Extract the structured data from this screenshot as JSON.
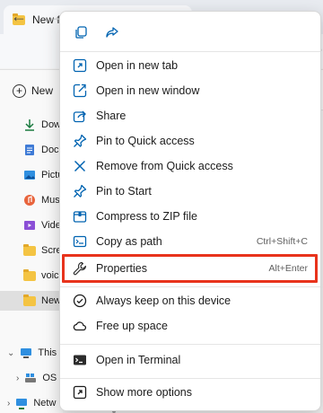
{
  "window": {
    "tab_title": "New fo",
    "address_hint": "p"
  },
  "command_bar": {
    "new_label": "New"
  },
  "sidebar": {
    "items": [
      {
        "label": "Down",
        "icon": "download-icon"
      },
      {
        "label": "Docu",
        "icon": "document-icon"
      },
      {
        "label": "Pictu",
        "icon": "pictures-icon"
      },
      {
        "label": "Musi",
        "icon": "music-icon"
      },
      {
        "label": "Video",
        "icon": "videos-icon"
      },
      {
        "label": "Scree",
        "icon": "folder-icon"
      },
      {
        "label": "voice",
        "icon": "folder-icon"
      },
      {
        "label": "New",
        "icon": "folder-icon"
      }
    ],
    "tree": [
      {
        "label": "This I",
        "icon": "pc-icon"
      },
      {
        "label": "OS",
        "icon": "drive-icon"
      },
      {
        "label": "Netw",
        "icon": "network-icon"
      }
    ]
  },
  "context_menu": {
    "quick_actions": [
      {
        "name": "copy-icon"
      },
      {
        "name": "share-icon"
      }
    ],
    "items": [
      {
        "label": "Open in new tab",
        "shortcut": "",
        "icon": "open-new-tab-icon"
      },
      {
        "label": "Open in new window",
        "shortcut": "",
        "icon": "open-new-window-icon"
      },
      {
        "label": "Share",
        "shortcut": "",
        "icon": "share-icon"
      },
      {
        "label": "Pin to Quick access",
        "shortcut": "",
        "icon": "pin-icon"
      },
      {
        "label": "Remove from Quick access",
        "shortcut": "",
        "icon": "remove-icon"
      },
      {
        "label": "Pin to Start",
        "shortcut": "",
        "icon": "pin-icon"
      },
      {
        "label": "Compress to ZIP file",
        "shortcut": "",
        "icon": "zip-icon"
      },
      {
        "label": "Copy as path",
        "shortcut": "Ctrl+Shift+C",
        "icon": "copy-path-icon"
      },
      {
        "label": "Properties",
        "shortcut": "Alt+Enter",
        "icon": "wrench-icon"
      },
      {
        "label": "Always keep on this device",
        "shortcut": "",
        "icon": "sync-icon"
      },
      {
        "label": "Free up space",
        "shortcut": "",
        "icon": "cloud-icon"
      },
      {
        "label": "Open in Terminal",
        "shortcut": "",
        "icon": "terminal-icon"
      },
      {
        "label": "Show more options",
        "shortcut": "",
        "icon": "more-options-icon"
      }
    ]
  },
  "colors": {
    "highlight": "#e8331c",
    "accent": "#0063b1"
  }
}
